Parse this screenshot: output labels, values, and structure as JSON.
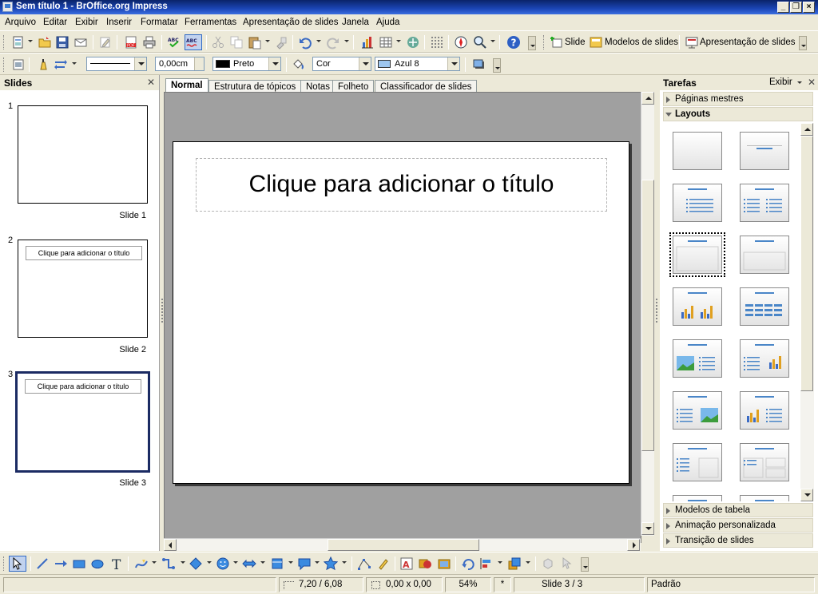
{
  "window": {
    "title": "Sem título 1 - BrOffice.org Impress"
  },
  "menu": [
    "Arquivo",
    "Editar",
    "Exibir",
    "Inserir",
    "Formatar",
    "Ferramentas",
    "Apresentação de slides",
    "Janela",
    "Ajuda"
  ],
  "toolbar_main": {
    "slide_label": "Slide",
    "templates_label": "Modelos de slides",
    "presentation_label": "Apresentação de slides"
  },
  "toolbar_line": {
    "line_width": "0,00cm",
    "line_color": "Preto",
    "line_color_hex": "#000000",
    "fill_type": "Cor",
    "fill_color": "Azul 8",
    "fill_color_hex": "#9ec6ef"
  },
  "slides_pane": {
    "title": "Slides",
    "slides": [
      {
        "number": "1",
        "label": "Slide 1",
        "title_text": ""
      },
      {
        "number": "2",
        "label": "Slide 2",
        "title_text": "Clique para adicionar o título"
      },
      {
        "number": "3",
        "label": "Slide 3",
        "title_text": "Clique para adicionar o título"
      }
    ]
  },
  "view_tabs": [
    "Normal",
    "Estrutura de tópicos",
    "Notas",
    "Folheto",
    "Classificador de slides"
  ],
  "active_tab": "Normal",
  "slide": {
    "title_placeholder": "Clique para adicionar o título"
  },
  "tasks_pane": {
    "title": "Tarefas",
    "view_menu": "Exibir",
    "sections_top": [
      {
        "label": "Páginas mestres",
        "open": false
      },
      {
        "label": "Layouts",
        "open": true
      }
    ],
    "sections_bottom": [
      {
        "label": "Modelos de tabela"
      },
      {
        "label": "Animação personalizada"
      },
      {
        "label": "Transição de slides"
      }
    ],
    "layouts": [
      "blank",
      "title-only-centered",
      "title-content",
      "title-2content",
      "title-only",
      "centered-text",
      "title-chart",
      "title-table",
      "title-image-text",
      "title-text-chart",
      "title-text-image",
      "title-chart-text",
      "title-text-box",
      "title-text-2box",
      "title-extra-1",
      "title-extra-2"
    ],
    "selected_layout": "title-only"
  },
  "status": {
    "position": "7,20 / 6,08",
    "size": "0,00 x 0,00",
    "zoom": "54%",
    "modified": "*",
    "slide": "Slide 3 / 3",
    "style": "Padrão"
  }
}
